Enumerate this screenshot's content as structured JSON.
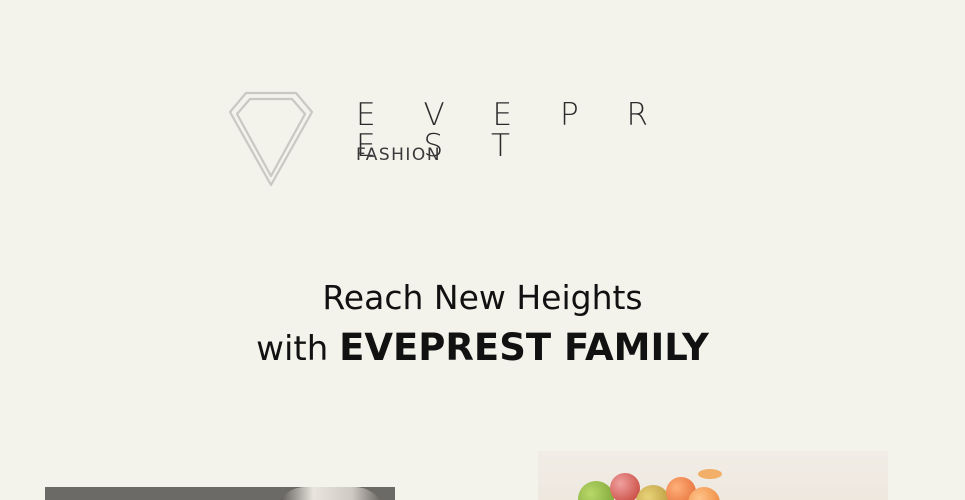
{
  "logo": {
    "wordmark": "E V E P R E S T",
    "tagline": "FASHION",
    "mark_icon": "diamond-outline-icon"
  },
  "headline": {
    "line1": "Reach New Heights",
    "line2_prefix": "with ",
    "line2_emphasis": "EVEPREST FAMILY"
  },
  "images": {
    "left": "portrait-photo",
    "right": "fruit-photo"
  },
  "colors": {
    "background": "#f3f2eb",
    "text": "#111111",
    "logo_stroke": "#c9c8c3"
  }
}
